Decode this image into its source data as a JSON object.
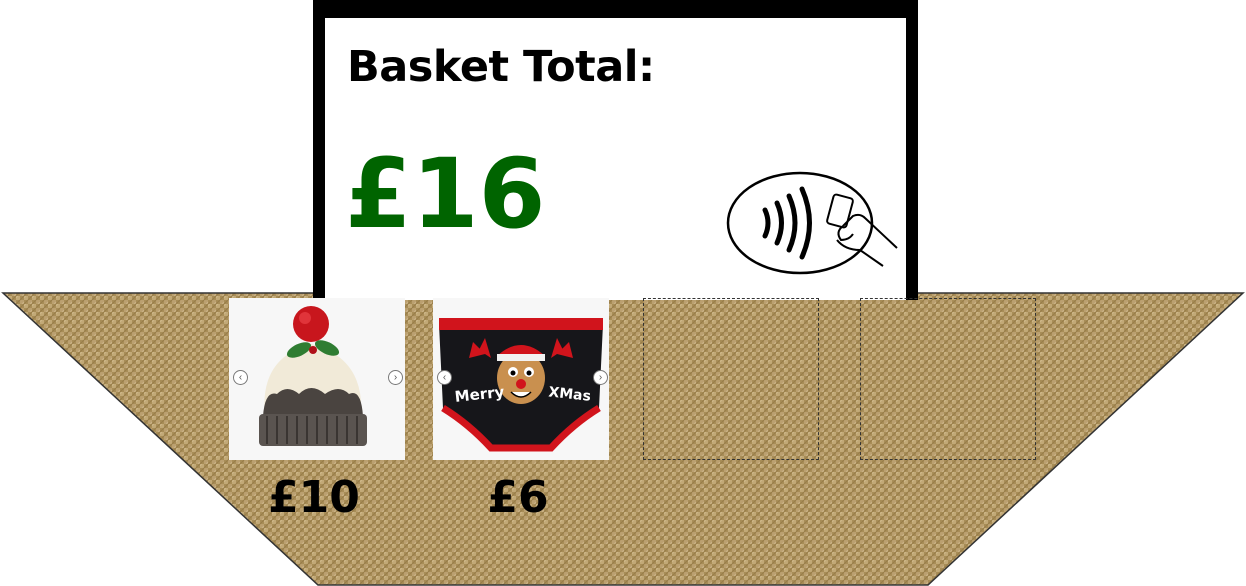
{
  "basket": {
    "total_label": "Basket Total:",
    "total_value": "£16",
    "items": [
      {
        "name": "hat",
        "price": "£10"
      },
      {
        "name": "briefs",
        "price": "£6",
        "print_left": "Merry",
        "print_right": "XMas"
      }
    ],
    "empty_slots": 2
  },
  "colors": {
    "total_value": "#006400",
    "frame": "#000000",
    "burlap": "#a58a55"
  },
  "icons": {
    "payment": "contactless-payment-icon",
    "prev": "chevron-left-icon",
    "next": "chevron-right-icon"
  }
}
